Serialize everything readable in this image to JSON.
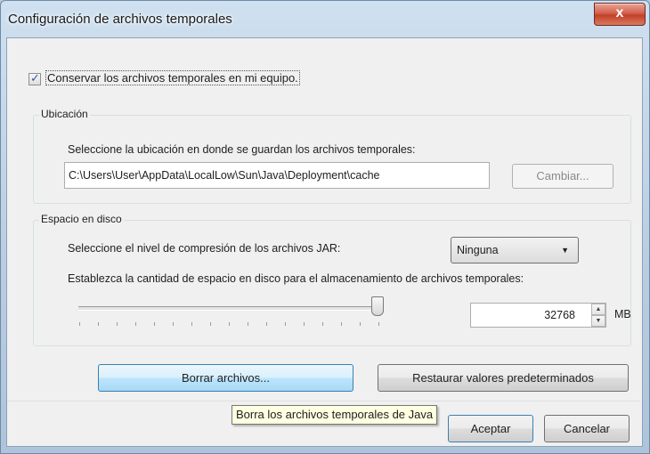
{
  "window": {
    "title": "Configuración de archivos temporales",
    "close_glyph": "x"
  },
  "keep_files": {
    "label": "Conservar los archivos temporales en mi equipo.",
    "checked": true,
    "check_glyph": "✓"
  },
  "location": {
    "legend": "Ubicación",
    "instruction": "Seleccione la ubicación en donde se guardan los archivos temporales:",
    "path": "C:\\Users\\User\\AppData\\LocalLow\\Sun\\Java\\Deployment\\cache",
    "change_label": "Cambiar..."
  },
  "disk": {
    "legend": "Espacio en disco",
    "compression_label": "Seleccione el nivel de compresión de los archivos JAR:",
    "compression_value": "Ninguna",
    "compression_arrow": "▼",
    "space_label": "Establezca la cantidad de espacio en disco para el almacenamiento de archivos temporales:",
    "space_value": "32768",
    "space_unit": "MB",
    "spin_up": "▲",
    "spin_down": "▼",
    "slider_level_fraction": 1.0
  },
  "actions": {
    "delete_label": "Borrar archivos...",
    "restore_label": "Restaurar valores predeterminados"
  },
  "tooltip": {
    "text": "Borra los archivos temporales de Java"
  },
  "footer": {
    "ok_label": "Aceptar",
    "cancel_label": "Cancelar"
  },
  "colors": {
    "close_button": "#c24128",
    "hover_button": "#bee6fd",
    "tooltip_bg": "#ffffe1"
  }
}
